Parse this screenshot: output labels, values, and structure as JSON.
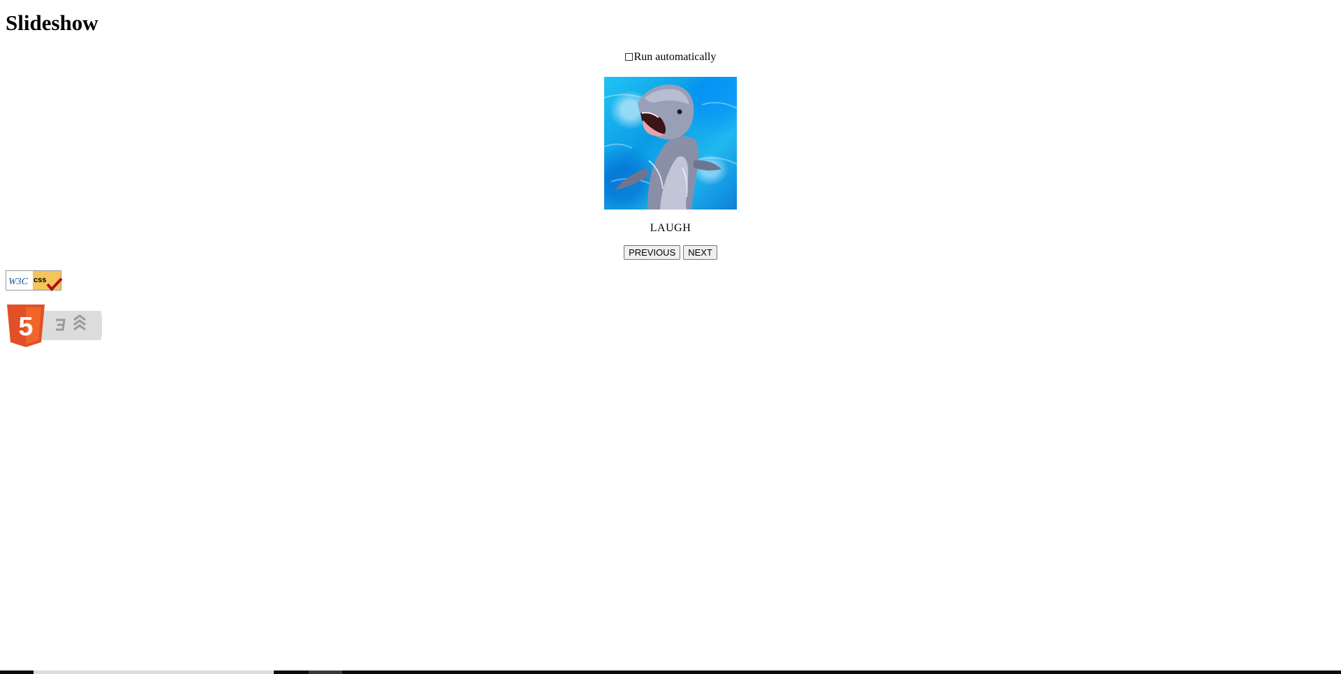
{
  "page": {
    "title": "Slideshow"
  },
  "slideshow": {
    "auto_label": "Run automatically",
    "auto_checked": false,
    "caption": "LAUGH",
    "image_subject": "dolphin",
    "prev_label": "PREVIOUS",
    "next_label": "NEXT"
  },
  "badges": {
    "w3c_css": {
      "text_left": "W3C",
      "text_right": "css"
    },
    "html5": {
      "text": "5"
    }
  },
  "colors": {
    "html5_orange": "#e34f26",
    "html5_dark_orange": "#c9461a",
    "w3c_blue": "#1b4f9b",
    "w3c_gold": "#f4c55a",
    "checkmark_red": "#b00f15",
    "water_blue": "#0a9be6"
  }
}
